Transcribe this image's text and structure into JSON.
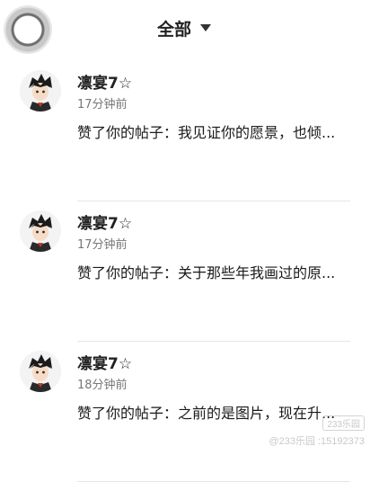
{
  "header": {
    "filter_label": "全部"
  },
  "notifications": [
    {
      "user_name": "凛宴7☆",
      "time": "17分钟前",
      "message": "赞了你的帖子：我见证你的愿景，也倾..."
    },
    {
      "user_name": "凛宴7☆",
      "time": "17分钟前",
      "message": "赞了你的帖子：关于那些年我画过的原..."
    },
    {
      "user_name": "凛宴7☆",
      "time": "18分钟前",
      "message": "赞了你的帖子：之前的是图片，现在升..."
    }
  ],
  "watermark": {
    "top": "233乐园",
    "bottom": "@233乐园 :15192373"
  }
}
